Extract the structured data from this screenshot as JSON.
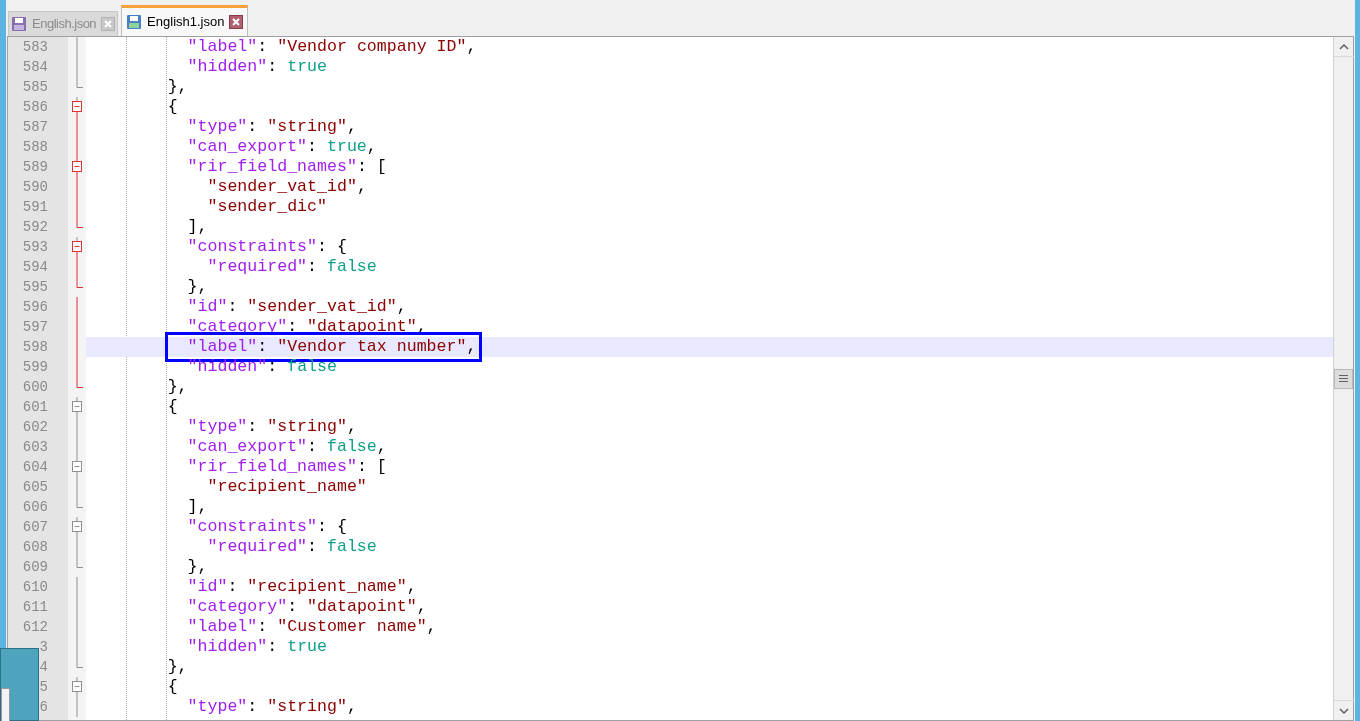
{
  "tabs": [
    {
      "label": "English.json",
      "selected": false
    },
    {
      "label": "English1.json",
      "selected": true
    }
  ],
  "editor": {
    "lines": [
      {
        "number": "583",
        "kind": "line",
        "fold_active": false,
        "tokens": [
          {
            "kind": "key",
            "text": "          \"label\""
          },
          {
            "kind": "punct",
            "text": ": "
          },
          {
            "kind": "string",
            "text": "\"Vendor company ID\""
          },
          {
            "kind": "punct",
            "text": ","
          }
        ]
      },
      {
        "number": "584",
        "kind": "line",
        "fold_active": false,
        "tokens": [
          {
            "kind": "key",
            "text": "          \"hidden\""
          },
          {
            "kind": "punct",
            "text": ": "
          },
          {
            "kind": "literal",
            "text": "true"
          }
        ]
      },
      {
        "number": "585",
        "kind": "end",
        "fold_active": false,
        "tokens": [
          {
            "kind": "punct",
            "text": "        },"
          }
        ]
      },
      {
        "number": "586",
        "kind": "open",
        "fold_active": true,
        "tokens": [
          {
            "kind": "punct",
            "text": "        {"
          }
        ]
      },
      {
        "number": "587",
        "kind": "line",
        "fold_active": true,
        "tokens": [
          {
            "kind": "key",
            "text": "          \"type\""
          },
          {
            "kind": "punct",
            "text": ": "
          },
          {
            "kind": "string",
            "text": "\"string\""
          },
          {
            "kind": "punct",
            "text": ","
          }
        ]
      },
      {
        "number": "588",
        "kind": "line",
        "fold_active": true,
        "tokens": [
          {
            "kind": "key",
            "text": "          \"can_export\""
          },
          {
            "kind": "punct",
            "text": ": "
          },
          {
            "kind": "literal",
            "text": "true"
          },
          {
            "kind": "punct",
            "text": ","
          }
        ]
      },
      {
        "number": "589",
        "kind": "open",
        "fold_active": true,
        "tokens": [
          {
            "kind": "key",
            "text": "          \"rir_field_names\""
          },
          {
            "kind": "punct",
            "text": ": ["
          }
        ]
      },
      {
        "number": "590",
        "kind": "line",
        "fold_active": true,
        "tokens": [
          {
            "kind": "string",
            "text": "            \"sender_vat_id\""
          },
          {
            "kind": "punct",
            "text": ","
          }
        ]
      },
      {
        "number": "591",
        "kind": "line",
        "fold_active": true,
        "tokens": [
          {
            "kind": "string",
            "text": "            \"sender_dic\""
          }
        ]
      },
      {
        "number": "592",
        "kind": "end",
        "fold_active": true,
        "tokens": [
          {
            "kind": "punct",
            "text": "          ],"
          }
        ]
      },
      {
        "number": "593",
        "kind": "open",
        "fold_active": true,
        "tokens": [
          {
            "kind": "key",
            "text": "          \"constraints\""
          },
          {
            "kind": "punct",
            "text": ": {"
          }
        ]
      },
      {
        "number": "594",
        "kind": "line",
        "fold_active": true,
        "tokens": [
          {
            "kind": "key",
            "text": "            \"required\""
          },
          {
            "kind": "punct",
            "text": ": "
          },
          {
            "kind": "literal",
            "text": "false"
          }
        ]
      },
      {
        "number": "595",
        "kind": "end",
        "fold_active": true,
        "tokens": [
          {
            "kind": "punct",
            "text": "          },"
          }
        ]
      },
      {
        "number": "596",
        "kind": "line",
        "fold_active": true,
        "tokens": [
          {
            "kind": "key",
            "text": "          \"id\""
          },
          {
            "kind": "punct",
            "text": ": "
          },
          {
            "kind": "string",
            "text": "\"sender_vat_id\""
          },
          {
            "kind": "punct",
            "text": ","
          }
        ]
      },
      {
        "number": "597",
        "kind": "line",
        "fold_active": true,
        "tokens": [
          {
            "kind": "key",
            "text": "          \"category\""
          },
          {
            "kind": "punct",
            "text": ": "
          },
          {
            "kind": "string",
            "text": "\"datapoint\""
          },
          {
            "kind": "punct",
            "text": ","
          }
        ]
      },
      {
        "number": "598",
        "kind": "line",
        "fold_active": true,
        "current": true,
        "boxed": true,
        "tokens": [
          {
            "kind": "key",
            "text": "          \"label\""
          },
          {
            "kind": "punct",
            "text": ": "
          },
          {
            "kind": "string",
            "text": "\"Vendor tax number\""
          },
          {
            "kind": "punct",
            "text": ","
          }
        ]
      },
      {
        "number": "599",
        "kind": "line",
        "fold_active": true,
        "tokens": [
          {
            "kind": "key",
            "text": "          \"hidden\""
          },
          {
            "kind": "punct",
            "text": ": "
          },
          {
            "kind": "literal",
            "text": "false"
          }
        ]
      },
      {
        "number": "600",
        "kind": "end",
        "fold_active": true,
        "tokens": [
          {
            "kind": "punct",
            "text": "        },"
          }
        ]
      },
      {
        "number": "601",
        "kind": "open",
        "fold_active": false,
        "tokens": [
          {
            "kind": "punct",
            "text": "        {"
          }
        ]
      },
      {
        "number": "602",
        "kind": "line",
        "fold_active": false,
        "tokens": [
          {
            "kind": "key",
            "text": "          \"type\""
          },
          {
            "kind": "punct",
            "text": ": "
          },
          {
            "kind": "string",
            "text": "\"string\""
          },
          {
            "kind": "punct",
            "text": ","
          }
        ]
      },
      {
        "number": "603",
        "kind": "line",
        "fold_active": false,
        "tokens": [
          {
            "kind": "key",
            "text": "          \"can_export\""
          },
          {
            "kind": "punct",
            "text": ": "
          },
          {
            "kind": "literal",
            "text": "false"
          },
          {
            "kind": "punct",
            "text": ","
          }
        ]
      },
      {
        "number": "604",
        "kind": "open",
        "fold_active": false,
        "tokens": [
          {
            "kind": "key",
            "text": "          \"rir_field_names\""
          },
          {
            "kind": "punct",
            "text": ": ["
          }
        ]
      },
      {
        "number": "605",
        "kind": "line",
        "fold_active": false,
        "tokens": [
          {
            "kind": "string",
            "text": "            \"recipient_name\""
          }
        ]
      },
      {
        "number": "606",
        "kind": "end",
        "fold_active": false,
        "tokens": [
          {
            "kind": "punct",
            "text": "          ],"
          }
        ]
      },
      {
        "number": "607",
        "kind": "open",
        "fold_active": false,
        "tokens": [
          {
            "kind": "key",
            "text": "          \"constraints\""
          },
          {
            "kind": "punct",
            "text": ": {"
          }
        ]
      },
      {
        "number": "608",
        "kind": "line",
        "fold_active": false,
        "tokens": [
          {
            "kind": "key",
            "text": "            \"required\""
          },
          {
            "kind": "punct",
            "text": ": "
          },
          {
            "kind": "literal",
            "text": "false"
          }
        ]
      },
      {
        "number": "609",
        "kind": "end",
        "fold_active": false,
        "tokens": [
          {
            "kind": "punct",
            "text": "          },"
          }
        ]
      },
      {
        "number": "610",
        "kind": "line",
        "fold_active": false,
        "tokens": [
          {
            "kind": "key",
            "text": "          \"id\""
          },
          {
            "kind": "punct",
            "text": ": "
          },
          {
            "kind": "string",
            "text": "\"recipient_name\""
          },
          {
            "kind": "punct",
            "text": ","
          }
        ]
      },
      {
        "number": "611",
        "kind": "line",
        "fold_active": false,
        "tokens": [
          {
            "kind": "key",
            "text": "          \"category\""
          },
          {
            "kind": "punct",
            "text": ": "
          },
          {
            "kind": "string",
            "text": "\"datapoint\""
          },
          {
            "kind": "punct",
            "text": ","
          }
        ]
      },
      {
        "number": "612",
        "kind": "line",
        "fold_active": false,
        "tokens": [
          {
            "kind": "key",
            "text": "          \"label\""
          },
          {
            "kind": "punct",
            "text": ": "
          },
          {
            "kind": "string",
            "text": "\"Customer name\""
          },
          {
            "kind": "punct",
            "text": ","
          }
        ]
      },
      {
        "number": "3",
        "kind": "line",
        "fold_active": false,
        "tokens": [
          {
            "kind": "key",
            "text": "          \"hidden\""
          },
          {
            "kind": "punct",
            "text": ": "
          },
          {
            "kind": "literal",
            "text": "true"
          }
        ]
      },
      {
        "number": "4",
        "kind": "end",
        "fold_active": false,
        "tokens": [
          {
            "kind": "punct",
            "text": "        },"
          }
        ]
      },
      {
        "number": "5",
        "kind": "open",
        "fold_active": false,
        "tokens": [
          {
            "kind": "punct",
            "text": "        {"
          }
        ]
      },
      {
        "number": "6",
        "kind": "line",
        "fold_active": false,
        "tokens": [
          {
            "kind": "key",
            "text": "          \"type\""
          },
          {
            "kind": "punct",
            "text": ": "
          },
          {
            "kind": "string",
            "text": "\"string\""
          },
          {
            "kind": "punct",
            "text": ","
          }
        ]
      }
    ]
  }
}
